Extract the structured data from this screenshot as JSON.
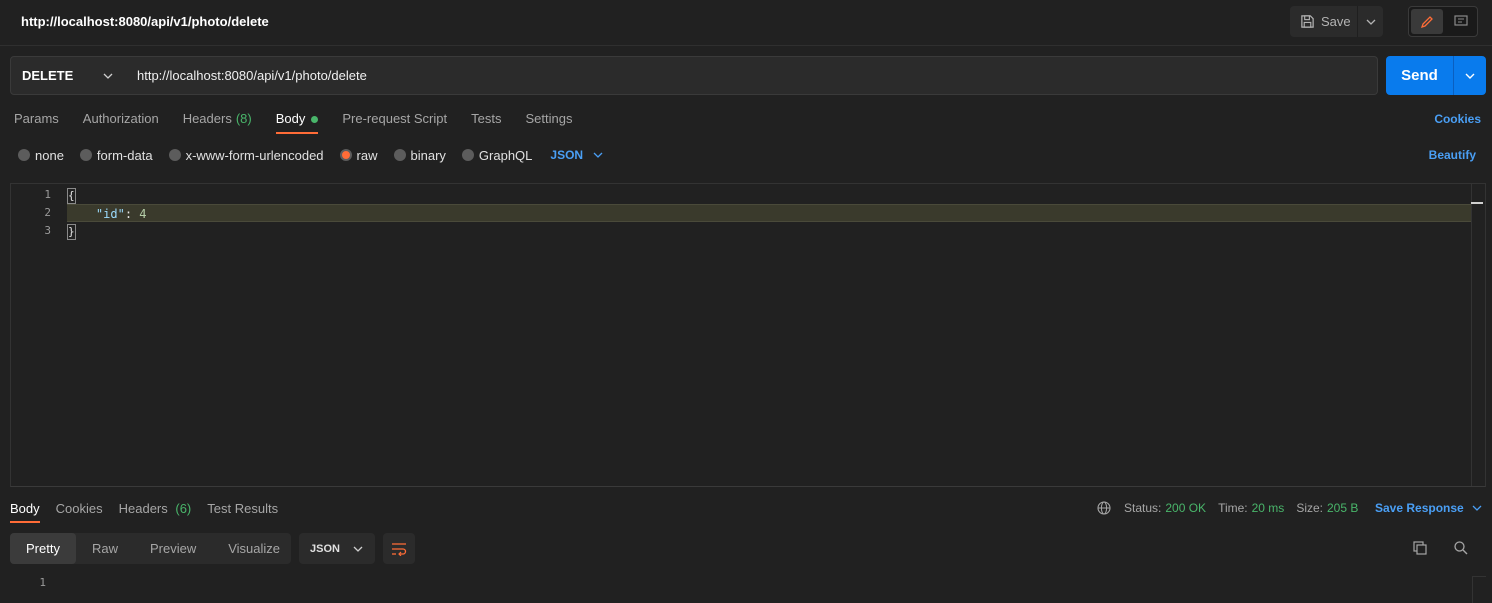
{
  "header": {
    "title": "http://localhost:8080/api/v1/photo/delete",
    "save_label": "Save"
  },
  "request": {
    "method": "DELETE",
    "url": "http://localhost:8080/api/v1/photo/delete",
    "send_label": "Send"
  },
  "request_tabs": {
    "params": "Params",
    "authorization": "Authorization",
    "headers": "Headers",
    "headers_count": "(8)",
    "body": "Body",
    "pre_request": "Pre-request Script",
    "tests": "Tests",
    "settings": "Settings",
    "cookies": "Cookies"
  },
  "body_types": {
    "none": "none",
    "form_data": "form-data",
    "urlencoded": "x-www-form-urlencoded",
    "raw": "raw",
    "binary": "binary",
    "graphql": "GraphQL",
    "selected": "raw",
    "language": "JSON",
    "beautify": "Beautify"
  },
  "editor": {
    "line_numbers": [
      "1",
      "2",
      "3"
    ],
    "open_brace": "{",
    "indent": "    ",
    "key": "\"id\"",
    "colon": ": ",
    "value": "4",
    "close_brace": "}"
  },
  "response": {
    "tabs": {
      "body": "Body",
      "cookies": "Cookies",
      "headers": "Headers",
      "headers_count": "(6)",
      "test_results": "Test Results"
    },
    "status_label": "Status:",
    "status_value": "200 OK",
    "time_label": "Time:",
    "time_value": "20 ms",
    "size_label": "Size:",
    "size_value": "205 B",
    "save_response": "Save Response",
    "views": {
      "pretty": "Pretty",
      "raw": "Raw",
      "preview": "Preview",
      "visualize": "Visualize"
    },
    "language": "JSON",
    "line_numbers": [
      "1"
    ]
  },
  "colors": {
    "accent_orange": "#ff6c37",
    "send_blue": "#097bed",
    "link_blue": "#4a9ff5",
    "success_green": "#49b56a"
  },
  "icons": [
    "save-icon",
    "chevron-down-icon",
    "pencil-icon",
    "comment-icon",
    "globe-icon",
    "copy-icon",
    "search-icon",
    "wrap-lines-icon"
  ]
}
